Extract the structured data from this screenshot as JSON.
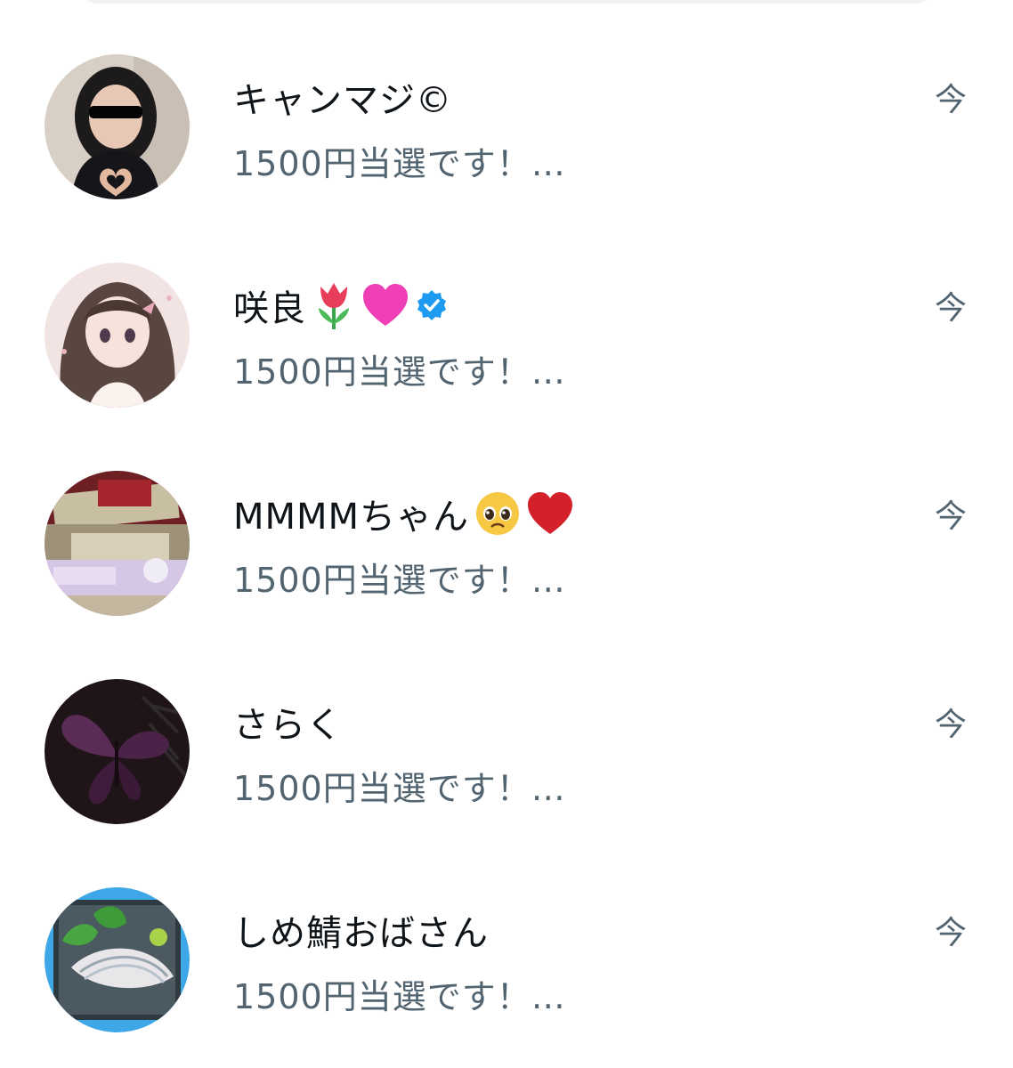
{
  "conversations": [
    {
      "name": "キャンマジ©",
      "preview": "1500円当選です！…",
      "time": "今",
      "avatar_icon": "girl-sunglasses-heart-avatar",
      "name_emojis": []
    },
    {
      "name": "咲良",
      "preview": "1500円当選です！…",
      "time": "今",
      "avatar_icon": "anime-girl-avatar",
      "name_emojis": [
        "tulip-emoji",
        "pink-heart-emoji"
      ],
      "verified": true
    },
    {
      "name": "MMMMちゃん",
      "preview": "1500円当選です！…",
      "time": "今",
      "avatar_icon": "money-stack-avatar",
      "name_emojis": [
        "pleading-face-emoji",
        "red-heart-emoji"
      ]
    },
    {
      "name": "さらく",
      "preview": "1500円当選です！…",
      "time": "今",
      "avatar_icon": "dark-butterfly-avatar",
      "name_emojis": []
    },
    {
      "name": "しめ鯖おばさん",
      "preview": "1500円当選です！…",
      "time": "今",
      "avatar_icon": "mackerel-sashimi-avatar",
      "name_emojis": []
    }
  ],
  "colors": {
    "name_text": "#0f1419",
    "secondary_text": "#536471",
    "verified_badge": "#1d9bf0",
    "background": "#ffffff"
  }
}
